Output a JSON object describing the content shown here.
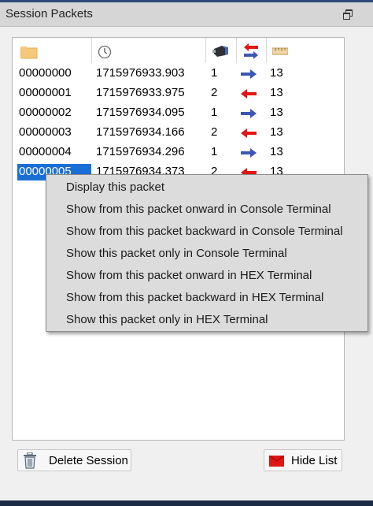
{
  "window": {
    "title": "Session Packets"
  },
  "icons": {
    "restore": "restore-window-icon",
    "col_index": "folder-icon",
    "col_time": "clock-icon",
    "col_direction": "device-icon",
    "col_arrow": "bidirectional-arrows-icon",
    "col_length": "ruler-icon"
  },
  "colors": {
    "selection": "#1a6fd6",
    "arrow_in": "#3b56b5",
    "arrow_out": "#e01515"
  },
  "packets": [
    {
      "index": "00000000",
      "time": "1715976933.903",
      "dir": "1",
      "arrow": "right",
      "len": "13"
    },
    {
      "index": "00000001",
      "time": "1715976933.975",
      "dir": "2",
      "arrow": "left",
      "len": "13"
    },
    {
      "index": "00000002",
      "time": "1715976934.095",
      "dir": "1",
      "arrow": "right",
      "len": "13"
    },
    {
      "index": "00000003",
      "time": "1715976934.166",
      "dir": "2",
      "arrow": "left",
      "len": "13"
    },
    {
      "index": "00000004",
      "time": "1715976934.296",
      "dir": "1",
      "arrow": "right",
      "len": "13"
    },
    {
      "index": "00000005",
      "time": "1715976934.373",
      "dir": "2",
      "arrow": "left",
      "len": "13"
    }
  ],
  "context_menu": {
    "items": [
      "Display this packet",
      "Show from this packet onward in Console Terminal",
      "Show from this packet backward in Console Terminal",
      "Show this packet only in Console Terminal",
      "Show from this packet onward in HEX Terminal",
      "Show from this packet backward in HEX Terminal",
      "Show this packet only in HEX Terminal"
    ]
  },
  "buttons": {
    "delete_session": "Delete Session",
    "hide_list": "Hide List"
  }
}
